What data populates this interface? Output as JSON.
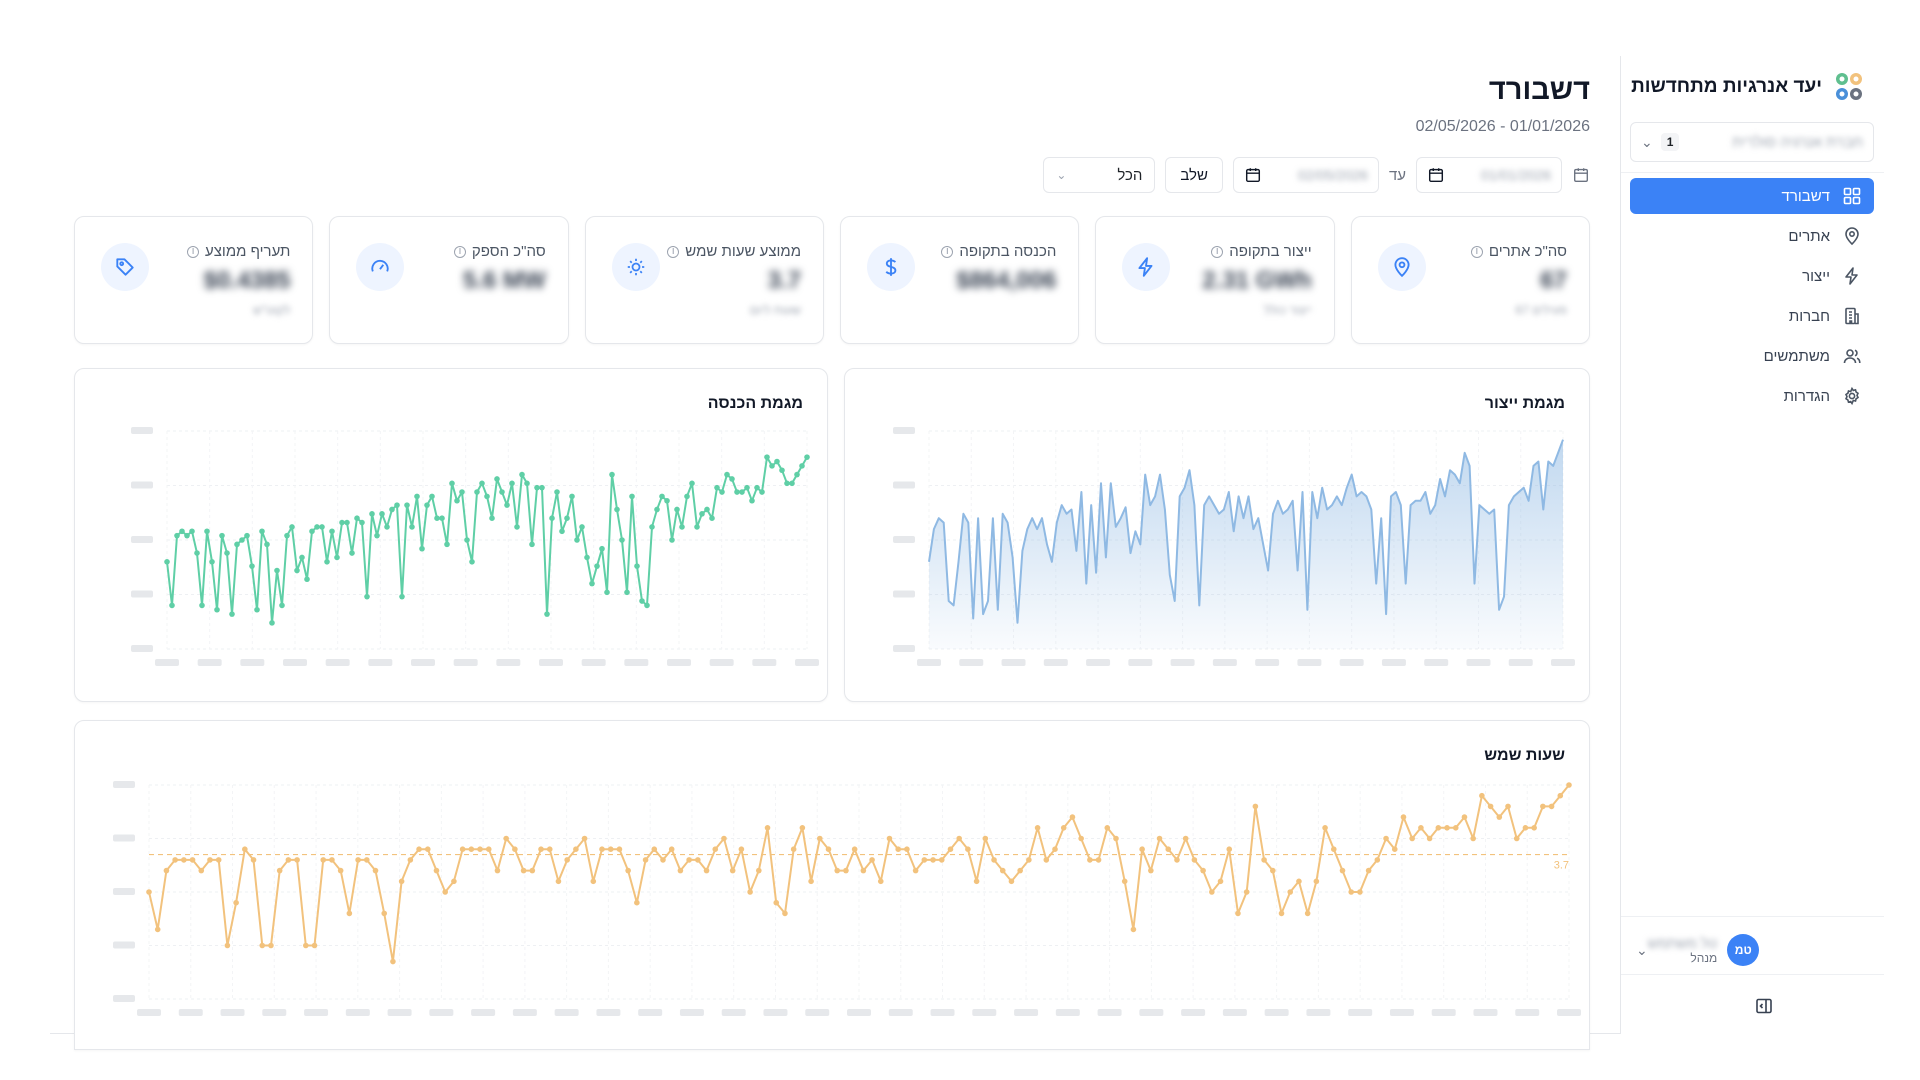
{
  "sidebar": {
    "brand": "יעד אנרגיות מתחדשות",
    "org_select": {
      "name": "חברת אנרגיה סולרית",
      "count": "1"
    },
    "nav": [
      {
        "label": "דשבורד",
        "icon": "dashboard-icon",
        "active": true
      },
      {
        "label": "אתרים",
        "icon": "map-pin-icon",
        "active": false
      },
      {
        "label": "ייצור",
        "icon": "lightning-icon",
        "active": false
      },
      {
        "label": "חברות",
        "icon": "building-icon",
        "active": false
      },
      {
        "label": "משתמשים",
        "icon": "users-icon",
        "active": false
      },
      {
        "label": "הגדרות",
        "icon": "gear-icon",
        "active": false
      }
    ],
    "user": {
      "initials": "טמ",
      "name": "טל משתמש",
      "role": "מנהל"
    }
  },
  "header": {
    "title": "דשבורד",
    "date_range": "02/05/2026 - 01/01/2026"
  },
  "filters": {
    "from_date": "01/01/2026",
    "until_label": "עד",
    "to_date": "02/05/2026",
    "merge_button": "שלב",
    "select_value": "הכל"
  },
  "kpis": [
    {
      "label": "סה\"כ אתרים",
      "value": "67",
      "sub": "67 פעילים",
      "icon": "map-pin-icon"
    },
    {
      "label": "ייצור בתקופה",
      "value": "2.31 GWh",
      "sub": "ייצור כולל",
      "icon": "lightning-icon"
    },
    {
      "label": "הכנסה בתקופה",
      "value": "$864,006",
      "sub": "",
      "icon": "dollar-icon"
    },
    {
      "label": "ממוצע שעות שמש",
      "value": "3.7",
      "sub": "שעות ליום",
      "icon": "sun-icon"
    },
    {
      "label": "סה\"כ הספק",
      "value": "5.6 MW",
      "sub": "",
      "icon": "gauge-icon"
    },
    {
      "label": "תעריף ממוצע",
      "value": "$0.4385",
      "sub": "לקוט\"ש",
      "icon": "tag-icon"
    }
  ],
  "colors": {
    "accent": "#3b82f6",
    "production": "#8fb9e3",
    "income": "#5fcfa6",
    "sun": "#f2c27d"
  },
  "charts": {
    "production_title": "מגמת ייצור",
    "income_title": "מגמת הכנסה",
    "sun_title": "שעות שמש",
    "sun_avg_label": "3.7"
  },
  "chart_data": [
    {
      "type": "area",
      "title": "מגמת ייצור",
      "ylim": [
        0,
        100
      ],
      "values": [
        40,
        55,
        60,
        58,
        22,
        20,
        40,
        62,
        58,
        14,
        60,
        16,
        22,
        60,
        18,
        62,
        58,
        42,
        12,
        45,
        55,
        60,
        55,
        60,
        48,
        40,
        58,
        66,
        62,
        64,
        45,
        72,
        30,
        66,
        35,
        76,
        42,
        76,
        56,
        60,
        65,
        44,
        54,
        48,
        80,
        66,
        70,
        80,
        64,
        34,
        22,
        70,
        74,
        82,
        66,
        20,
        66,
        70,
        66,
        62,
        64,
        72,
        54,
        70,
        60,
        70,
        55,
        60,
        48,
        36,
        62,
        68,
        62,
        64,
        68,
        36,
        72,
        18,
        72,
        60,
        74,
        64,
        66,
        70,
        66,
        74,
        80,
        70,
        72,
        70,
        64,
        30,
        60,
        16,
        70,
        72,
        66,
        30,
        66,
        68,
        68,
        72,
        62,
        66,
        78,
        70,
        82,
        80,
        76,
        90,
        84,
        30,
        66,
        64,
        62,
        64,
        18,
        24,
        66,
        70,
        72,
        74,
        68,
        84,
        86,
        64,
        86,
        84,
        90,
        96
      ]
    },
    {
      "type": "line",
      "title": "מגמת הכנסה",
      "ylim": [
        0,
        100
      ],
      "values": [
        40,
        20,
        52,
        54,
        52,
        54,
        44,
        20,
        54,
        40,
        18,
        52,
        44,
        16,
        48,
        50,
        52,
        38,
        18,
        54,
        48,
        12,
        36,
        20,
        52,
        56,
        36,
        42,
        32,
        54,
        56,
        56,
        40,
        54,
        42,
        58,
        58,
        44,
        60,
        58,
        24,
        62,
        52,
        62,
        56,
        64,
        66,
        24,
        66,
        56,
        70,
        46,
        66,
        70,
        60,
        60,
        48,
        76,
        68,
        72,
        50,
        40,
        72,
        76,
        70,
        60,
        78,
        72,
        66,
        76,
        56,
        80,
        76,
        48,
        74,
        74,
        16,
        60,
        72,
        54,
        60,
        70,
        50,
        56,
        42,
        30,
        38,
        46,
        26,
        80,
        64,
        50,
        26,
        70,
        38,
        22,
        20,
        56,
        64,
        70,
        68,
        50,
        64,
        56,
        70,
        76,
        56,
        62,
        64,
        60,
        74,
        72,
        80,
        78,
        72,
        72,
        74,
        68,
        74,
        72,
        88,
        84,
        86,
        82,
        76,
        76,
        80,
        84,
        88
      ]
    },
    {
      "type": "line",
      "title": "שעות שמש",
      "ylim": [
        1,
        5
      ],
      "average": 3.7,
      "values": [
        3.0,
        2.3,
        3.4,
        3.6,
        3.6,
        3.6,
        3.4,
        3.6,
        3.6,
        2.0,
        2.8,
        3.8,
        3.6,
        2.0,
        2.0,
        3.4,
        3.6,
        3.6,
        2.0,
        2.0,
        3.6,
        3.6,
        3.4,
        2.6,
        3.6,
        3.6,
        3.4,
        2.6,
        1.7,
        3.2,
        3.6,
        3.8,
        3.8,
        3.4,
        3.0,
        3.2,
        3.8,
        3.8,
        3.8,
        3.8,
        3.4,
        4.0,
        3.8,
        3.4,
        3.4,
        3.8,
        3.8,
        3.2,
        3.6,
        3.8,
        4.0,
        3.2,
        3.8,
        3.8,
        3.8,
        3.4,
        2.8,
        3.6,
        3.8,
        3.6,
        3.8,
        3.4,
        3.6,
        3.6,
        3.4,
        3.8,
        4.0,
        3.4,
        3.8,
        3.0,
        3.4,
        4.2,
        2.8,
        2.6,
        3.8,
        4.2,
        3.2,
        4.0,
        3.8,
        3.4,
        3.4,
        3.8,
        3.4,
        3.6,
        3.2,
        4.0,
        3.8,
        3.8,
        3.4,
        3.6,
        3.6,
        3.6,
        3.8,
        4.0,
        3.8,
        3.2,
        4.0,
        3.6,
        3.4,
        3.2,
        3.4,
        3.6,
        4.2,
        3.6,
        3.8,
        4.2,
        4.4,
        4.0,
        3.6,
        3.6,
        4.2,
        4.0,
        3.2,
        2.3,
        3.8,
        3.4,
        4.0,
        3.8,
        3.6,
        4.0,
        3.6,
        3.4,
        3.0,
        3.2,
        3.8,
        2.6,
        3.0,
        4.6,
        3.6,
        3.4,
        2.6,
        3.0,
        3.2,
        2.6,
        3.2,
        4.2,
        3.8,
        3.4,
        3.0,
        3.0,
        3.4,
        3.6,
        4.0,
        3.8,
        4.4,
        4.0,
        4.2,
        4.0,
        4.2,
        4.2,
        4.2,
        4.4,
        4.0,
        4.8,
        4.6,
        4.4,
        4.6,
        4.0,
        4.2,
        4.2,
        4.6,
        4.6,
        4.8,
        5.0
      ]
    }
  ]
}
